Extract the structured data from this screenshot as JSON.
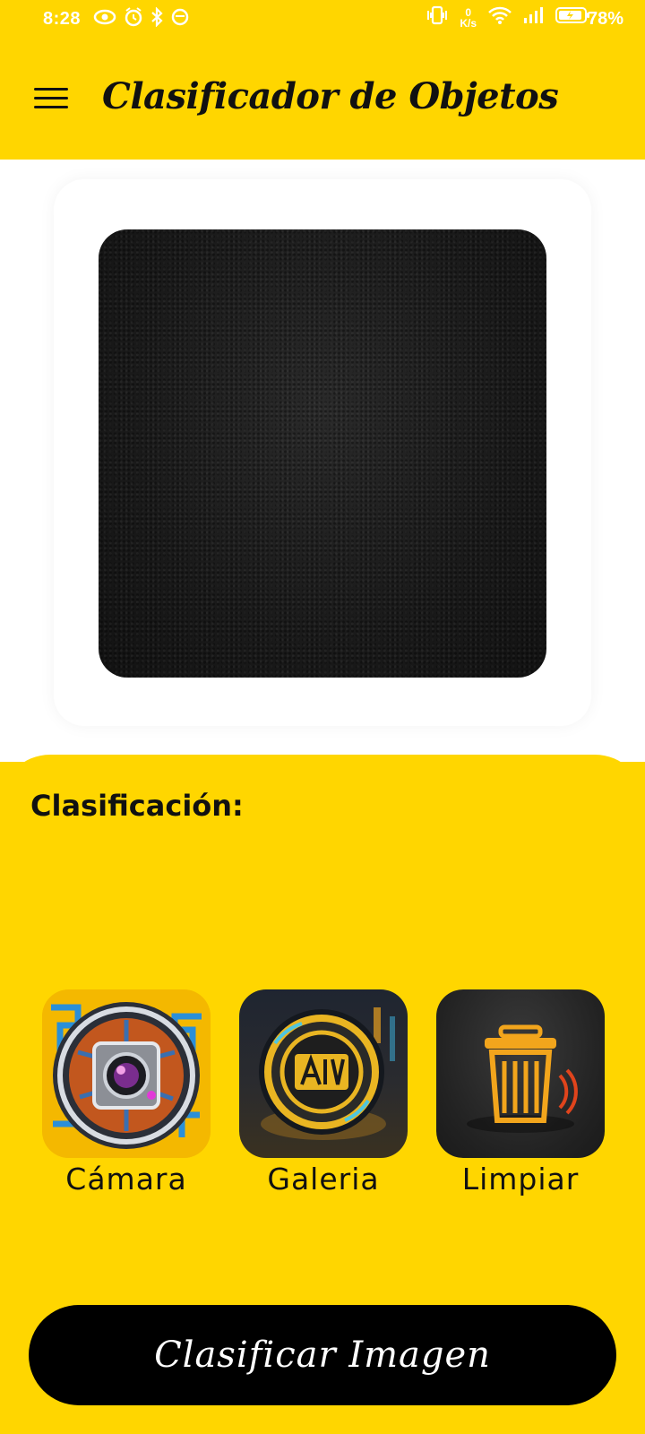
{
  "status_bar": {
    "time": "8:28",
    "speed_value": "0",
    "speed_unit": "K/s",
    "battery": "78%"
  },
  "app_bar": {
    "title": "Clasificador de Objetos",
    "menu_icon": "hamburger-menu-icon"
  },
  "classification": {
    "label": "Clasificación:",
    "result": ""
  },
  "actions": [
    {
      "label": "Cámara",
      "icon": "camera-icon"
    },
    {
      "label": "Galeria",
      "icon": "ai-gallery-icon"
    },
    {
      "label": "Limpiar",
      "icon": "trash-icon"
    }
  ],
  "classify_button": {
    "label": "Clasificar Imagen"
  },
  "colors": {
    "accent": "#FFD600",
    "button": "#000000",
    "panel": "#FFFFFF"
  }
}
